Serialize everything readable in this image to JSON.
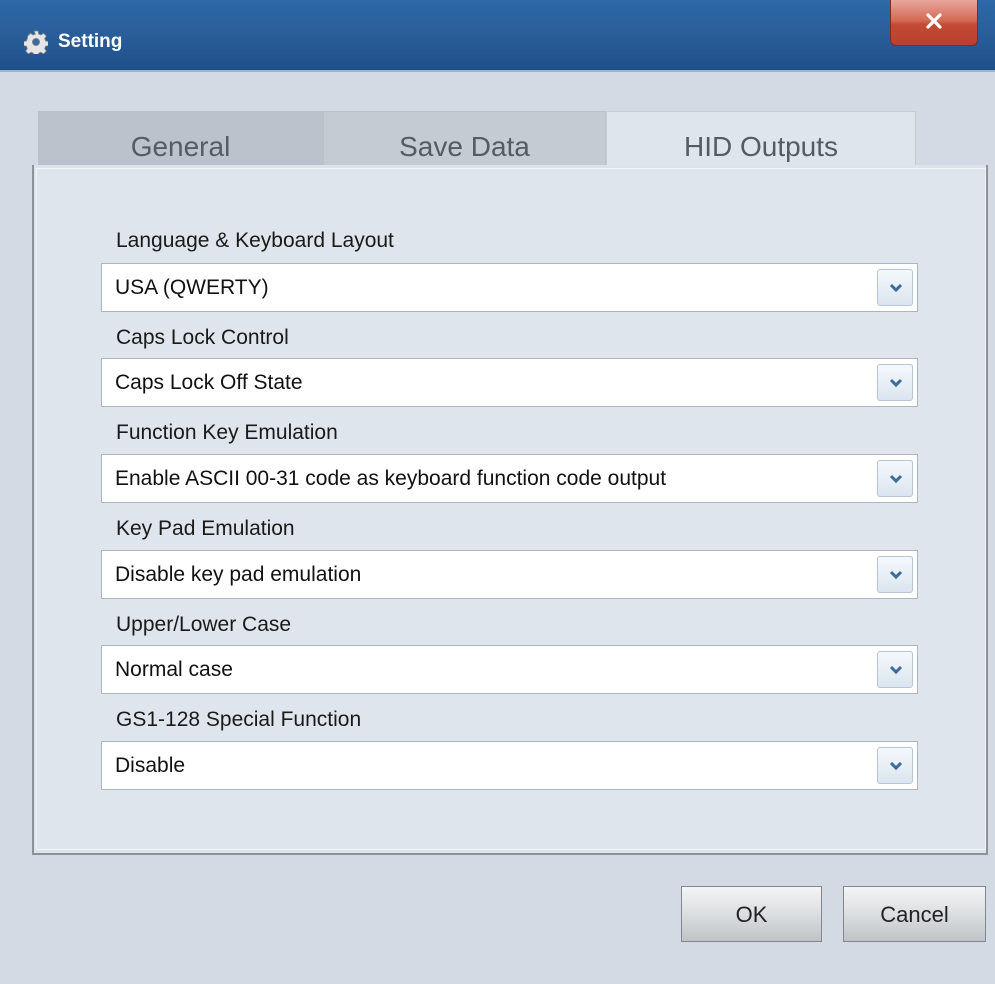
{
  "window": {
    "title": "Setting",
    "title_icon": "gear-icon",
    "close_label": "x"
  },
  "tabs": [
    {
      "label": "General",
      "active": false
    },
    {
      "label": "Save Data",
      "active": false
    },
    {
      "label": "HID Outputs",
      "active": true
    }
  ],
  "fields": [
    {
      "label": "Language & Keyboard Layout",
      "value": "USA (QWERTY)"
    },
    {
      "label": "Caps Lock Control",
      "value": "Caps Lock Off State"
    },
    {
      "label": "Function Key Emulation",
      "value": "Enable ASCII 00-31 code as keyboard function code output"
    },
    {
      "label": "Key Pad Emulation",
      "value": "Disable key pad emulation"
    },
    {
      "label": "Upper/Lower Case",
      "value": "Normal case"
    },
    {
      "label": "GS1-128 Special Function",
      "value": "Disable"
    }
  ],
  "buttons": {
    "ok": "OK",
    "cancel": "Cancel"
  },
  "colors": {
    "titlebar": "#2a5f9b",
    "close": "#c24a36",
    "panel": "#dfe5ec"
  }
}
